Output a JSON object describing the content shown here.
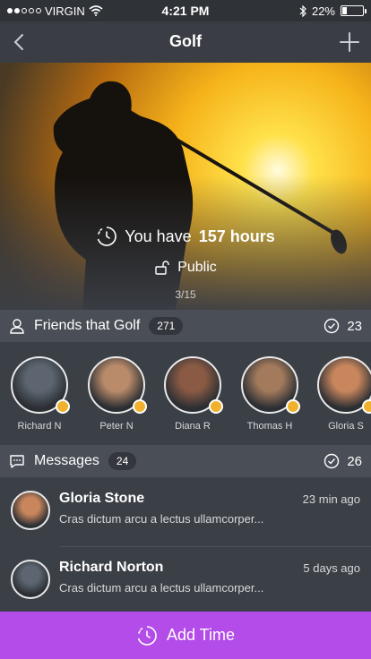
{
  "status": {
    "carrier": "VIRGIN",
    "time": "4:21 PM",
    "battery": "22%",
    "battery_level": 0.22
  },
  "nav": {
    "title": "Golf"
  },
  "hero": {
    "hours_prefix": "You have",
    "hours_value": "157 hours",
    "visibility": "Public",
    "page_indicator": "3/15"
  },
  "friends_header": {
    "label": "Friends that Golf",
    "count": "271",
    "check_count": "23"
  },
  "friends": [
    {
      "name": "Richard N",
      "color": "#5d6670"
    },
    {
      "name": "Peter N",
      "color": "#b98b6a"
    },
    {
      "name": "Diana R",
      "color": "#8a5a44"
    },
    {
      "name": "Thomas H",
      "color": "#a37a5c"
    },
    {
      "name": "Gloria S",
      "color": "#c9865d"
    }
  ],
  "messages_header": {
    "label": "Messages",
    "count": "24",
    "check_count": "26"
  },
  "messages": [
    {
      "name": "Gloria Stone",
      "time": "23 min ago",
      "text": "Cras dictum arcu a lectus ullamcorper...",
      "color": "#c9865d"
    },
    {
      "name": "Richard Norton",
      "time": "5 days ago",
      "text": "Cras dictum arcu a lectus ullamcorper...",
      "color": "#5d6670"
    }
  ],
  "cta": {
    "label": "Add Time"
  },
  "colors": {
    "accent": "#b34ce8",
    "background": "#3b3f46",
    "section": "#4a4e56",
    "medal": "#f0b22d"
  }
}
